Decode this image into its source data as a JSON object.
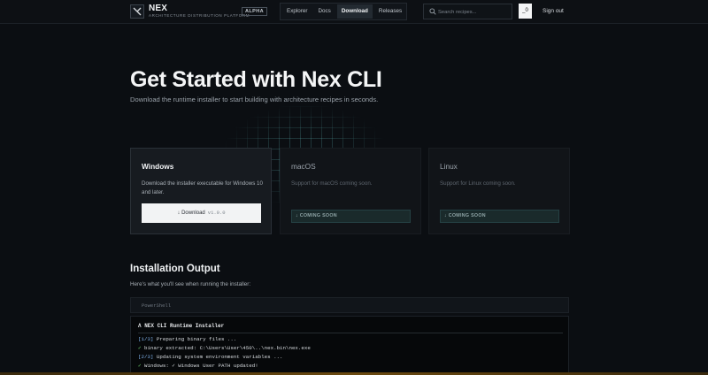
{
  "header": {
    "brand_name": "NEX",
    "brand_subtitle": "ARCHITECTURE DISTRIBUTION PLATFORM",
    "badge": "ALPHA",
    "nav": [
      {
        "label": "Explorer",
        "active": false
      },
      {
        "label": "Docs",
        "active": false
      },
      {
        "label": "Download",
        "active": true
      },
      {
        "label": "Releases",
        "active": false
      }
    ],
    "search_placeholder": "Search recipes...",
    "avatar_label": "_0",
    "signout_label": "Sign out"
  },
  "hero": {
    "title": "Get Started with Nex CLI",
    "subtitle": "Download the runtime installer to start building with architecture recipes in seconds."
  },
  "platforms": [
    {
      "name": "Windows",
      "description": "Download the installer executable for Windows 10 and later.",
      "button_label": "↓ Download",
      "version": "v1.0.0"
    },
    {
      "name": "macOS",
      "description": "Support for macOS coming soon.",
      "button_label": "↓ COMING SOON"
    },
    {
      "name": "Linux",
      "description": "Support for Linux coming soon.",
      "button_label": "↓ COMING SOON"
    }
  ],
  "installation": {
    "title": "Installation Output",
    "subtitle": "Here's what you'll see when running the installer:",
    "shell_label": "PowerShell",
    "terminal_header": "Λ NEX CLI Runtime Installer",
    "lines": [
      {
        "prefix": "[1/3]",
        "text": " Preparing binary files ..."
      },
      {
        "prefix": "✓",
        "text": " binary extracted: C:\\Users\\User\\450\\..\\nex.bin\\nex.exe"
      },
      {
        "prefix": "[2/3]",
        "text": " Updating system environment variables ..."
      },
      {
        "prefix": "✓",
        "text": " Windows: ✓ Windows User PATH updated!"
      }
    ]
  },
  "colors": {
    "background": "#0b0e12",
    "accent_teal": "#244043",
    "success_green": "#6fd36f",
    "step_blue": "#7fb0e8"
  }
}
